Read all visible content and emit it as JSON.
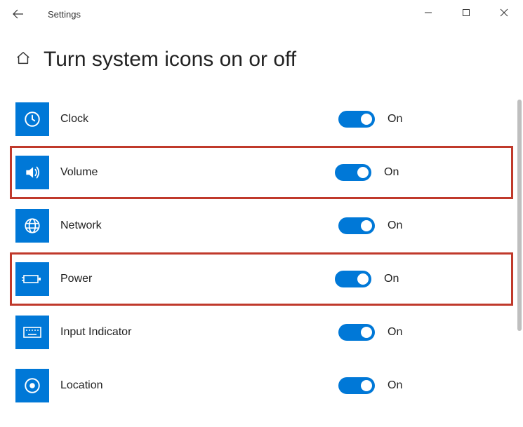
{
  "window": {
    "app_title": "Settings"
  },
  "header": {
    "title": "Turn system icons on or off"
  },
  "toggle_labels": {
    "on": "On"
  },
  "items": [
    {
      "id": "clock",
      "label": "Clock",
      "state": "On",
      "highlighted": false
    },
    {
      "id": "volume",
      "label": "Volume",
      "state": "On",
      "highlighted": true
    },
    {
      "id": "network",
      "label": "Network",
      "state": "On",
      "highlighted": false
    },
    {
      "id": "power",
      "label": "Power",
      "state": "On",
      "highlighted": true
    },
    {
      "id": "input-indicator",
      "label": "Input Indicator",
      "state": "On",
      "highlighted": false
    },
    {
      "id": "location",
      "label": "Location",
      "state": "On",
      "highlighted": false
    }
  ],
  "colors": {
    "accent": "#0078d7",
    "highlight_border": "#c0392b"
  }
}
